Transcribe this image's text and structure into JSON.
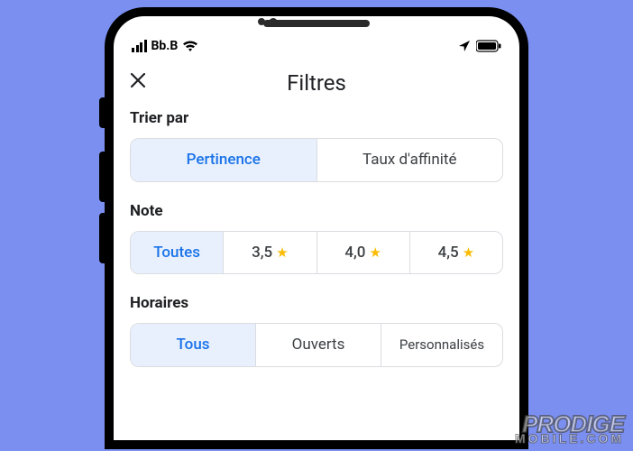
{
  "status": {
    "carrier": "Bb.B"
  },
  "header": {
    "title": "Filtres"
  },
  "sections": {
    "sort": {
      "label": "Trier par",
      "options": [
        "Pertinence",
        "Taux d'affinité"
      ]
    },
    "rating": {
      "label": "Note",
      "options": [
        "Toutes",
        "3,5",
        "4,0",
        "4,5"
      ]
    },
    "hours": {
      "label": "Horaires",
      "options": [
        "Tous",
        "Ouverts",
        "Personnalisés"
      ]
    }
  },
  "watermark": {
    "line1": "PRODIGE",
    "line2": "MOBILE.COM"
  }
}
